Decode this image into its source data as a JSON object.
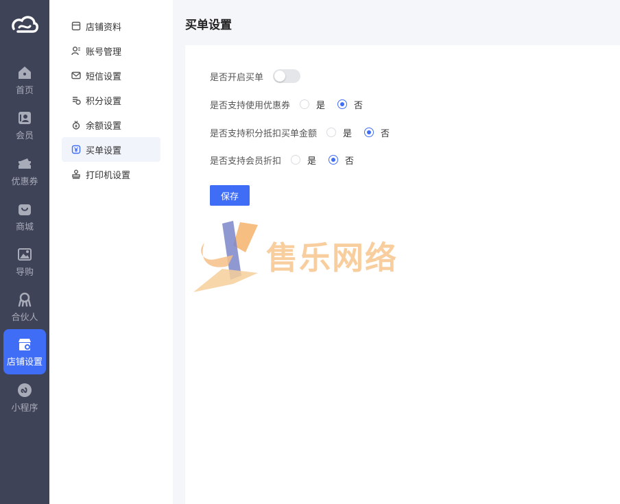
{
  "nav": {
    "items": [
      {
        "label": "首页",
        "icon": "home-icon"
      },
      {
        "label": "会员",
        "icon": "member-card-icon"
      },
      {
        "label": "优惠券",
        "icon": "coupon-icon"
      },
      {
        "label": "商城",
        "icon": "shopping-bag-icon"
      },
      {
        "label": "导购",
        "icon": "image-icon"
      },
      {
        "label": "合伙人",
        "icon": "partner-icon"
      },
      {
        "label": "店铺设置",
        "icon": "store-settings-icon"
      },
      {
        "label": "小程序",
        "icon": "mini-program-icon"
      }
    ],
    "active": "店铺设置"
  },
  "submenu": {
    "items": [
      {
        "label": "店铺资料",
        "icon": "store-icon"
      },
      {
        "label": "账号管理",
        "icon": "user-manage-icon"
      },
      {
        "label": "短信设置",
        "icon": "mail-icon"
      },
      {
        "label": "积分设置",
        "icon": "points-icon"
      },
      {
        "label": "余额设置",
        "icon": "wallet-icon"
      },
      {
        "label": "买单设置",
        "icon": "yen-icon"
      },
      {
        "label": "打印机设置",
        "icon": "printer-icon"
      }
    ],
    "active": "买单设置"
  },
  "page": {
    "title": "买单设置",
    "form": {
      "enable_checkout": {
        "label": "是否开启买单",
        "value": false
      },
      "coupon": {
        "label": "是否支持使用优惠券",
        "options": [
          "是",
          "否"
        ],
        "selected": "否"
      },
      "points": {
        "label": "是否支持积分抵扣买单金额",
        "options": [
          "是",
          "否"
        ],
        "selected": "否"
      },
      "member_discount": {
        "label": "是否支持会员折扣",
        "options": [
          "是",
          "否"
        ],
        "selected": "否"
      }
    },
    "save_label": "保存"
  },
  "watermark": {
    "text": "售乐网络"
  },
  "colors": {
    "accent": "#3f6df5",
    "nav_bg": "#3f4357",
    "watermark": "#f9c994"
  }
}
